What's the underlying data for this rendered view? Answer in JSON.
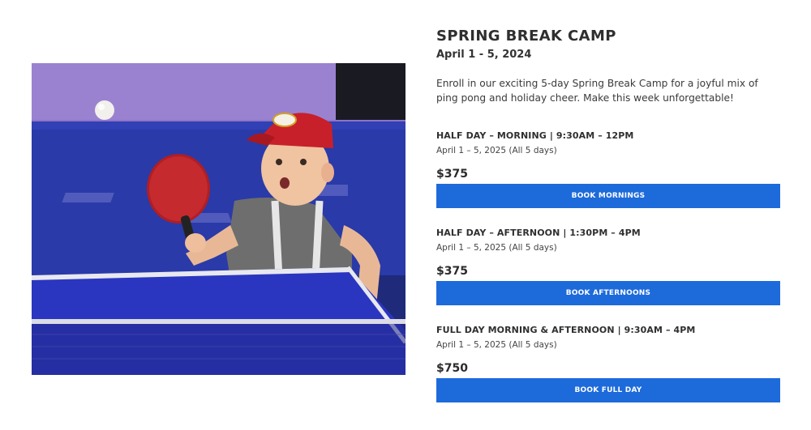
{
  "camp": {
    "title": "SPRING BREAK CAMP",
    "dates": "April 1 - 5, 2024",
    "description": "Enroll in our exciting 5-day Spring Break Camp for a joyful mix of ping pong and holiday cheer.  Make this week unforgettable!"
  },
  "photo": {
    "subject": "child-playing-ping-pong"
  },
  "options": [
    {
      "heading": "HALF DAY – MORNING | 9:30AM – 12PM",
      "dates": "April 1 – 5, 2025 (All 5 days)",
      "price": "$375",
      "button_label": "BOOK MORNINGS"
    },
    {
      "heading": "HALF DAY – AFTERNOON | 1:30PM – 4PM",
      "dates": "April 1 – 5, 2025 (All 5 days)",
      "price": "$375",
      "button_label": "BOOK AFTERNOONS"
    },
    {
      "heading": "FULL DAY MORNING & AFTERNOON | 9:30AM – 4PM",
      "dates": "April 1 – 5, 2025 (All 5 days)",
      "price": "$750",
      "button_label": "BOOK FULL DAY"
    }
  ],
  "colors": {
    "button": "#1d6adb",
    "text": "#2f2f2f"
  }
}
